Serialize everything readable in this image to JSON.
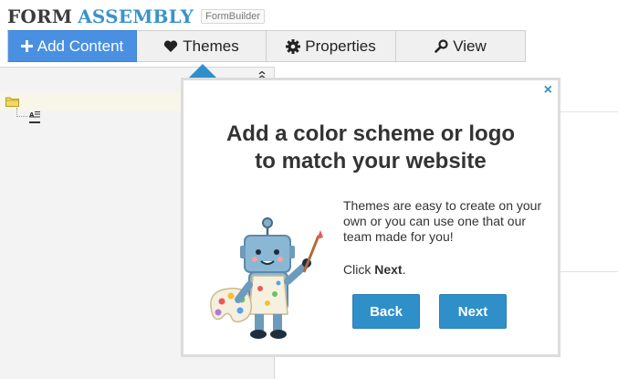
{
  "logo": {
    "part1": "FORM",
    "part2": "ASSEMBLY",
    "badge": "FormBuilder"
  },
  "toolbar": {
    "add_label": "Add Content",
    "themes_label": "Themes",
    "properties_label": "Properties",
    "view_label": "View"
  },
  "popover": {
    "title_line1": "Add a color scheme or logo",
    "title_line2": "to match your website",
    "body": "Themes are easy to create on your own or you can use one that our team made for you!",
    "click_prefix": "Click ",
    "click_bold": "Next",
    "click_suffix": ".",
    "back_label": "Back",
    "next_label": "Next",
    "close_label": "×"
  },
  "colors": {
    "accent": "#2f8fc9",
    "add_button": "#4a90e2",
    "logo_blue": "#3a93c9",
    "logo_dark": "#3b3b3b"
  },
  "icons": [
    "plus-icon",
    "heart-icon",
    "gear-icon",
    "magnifier-icon",
    "folder-icon",
    "text-icon",
    "close-icon",
    "robot-illustration"
  ]
}
